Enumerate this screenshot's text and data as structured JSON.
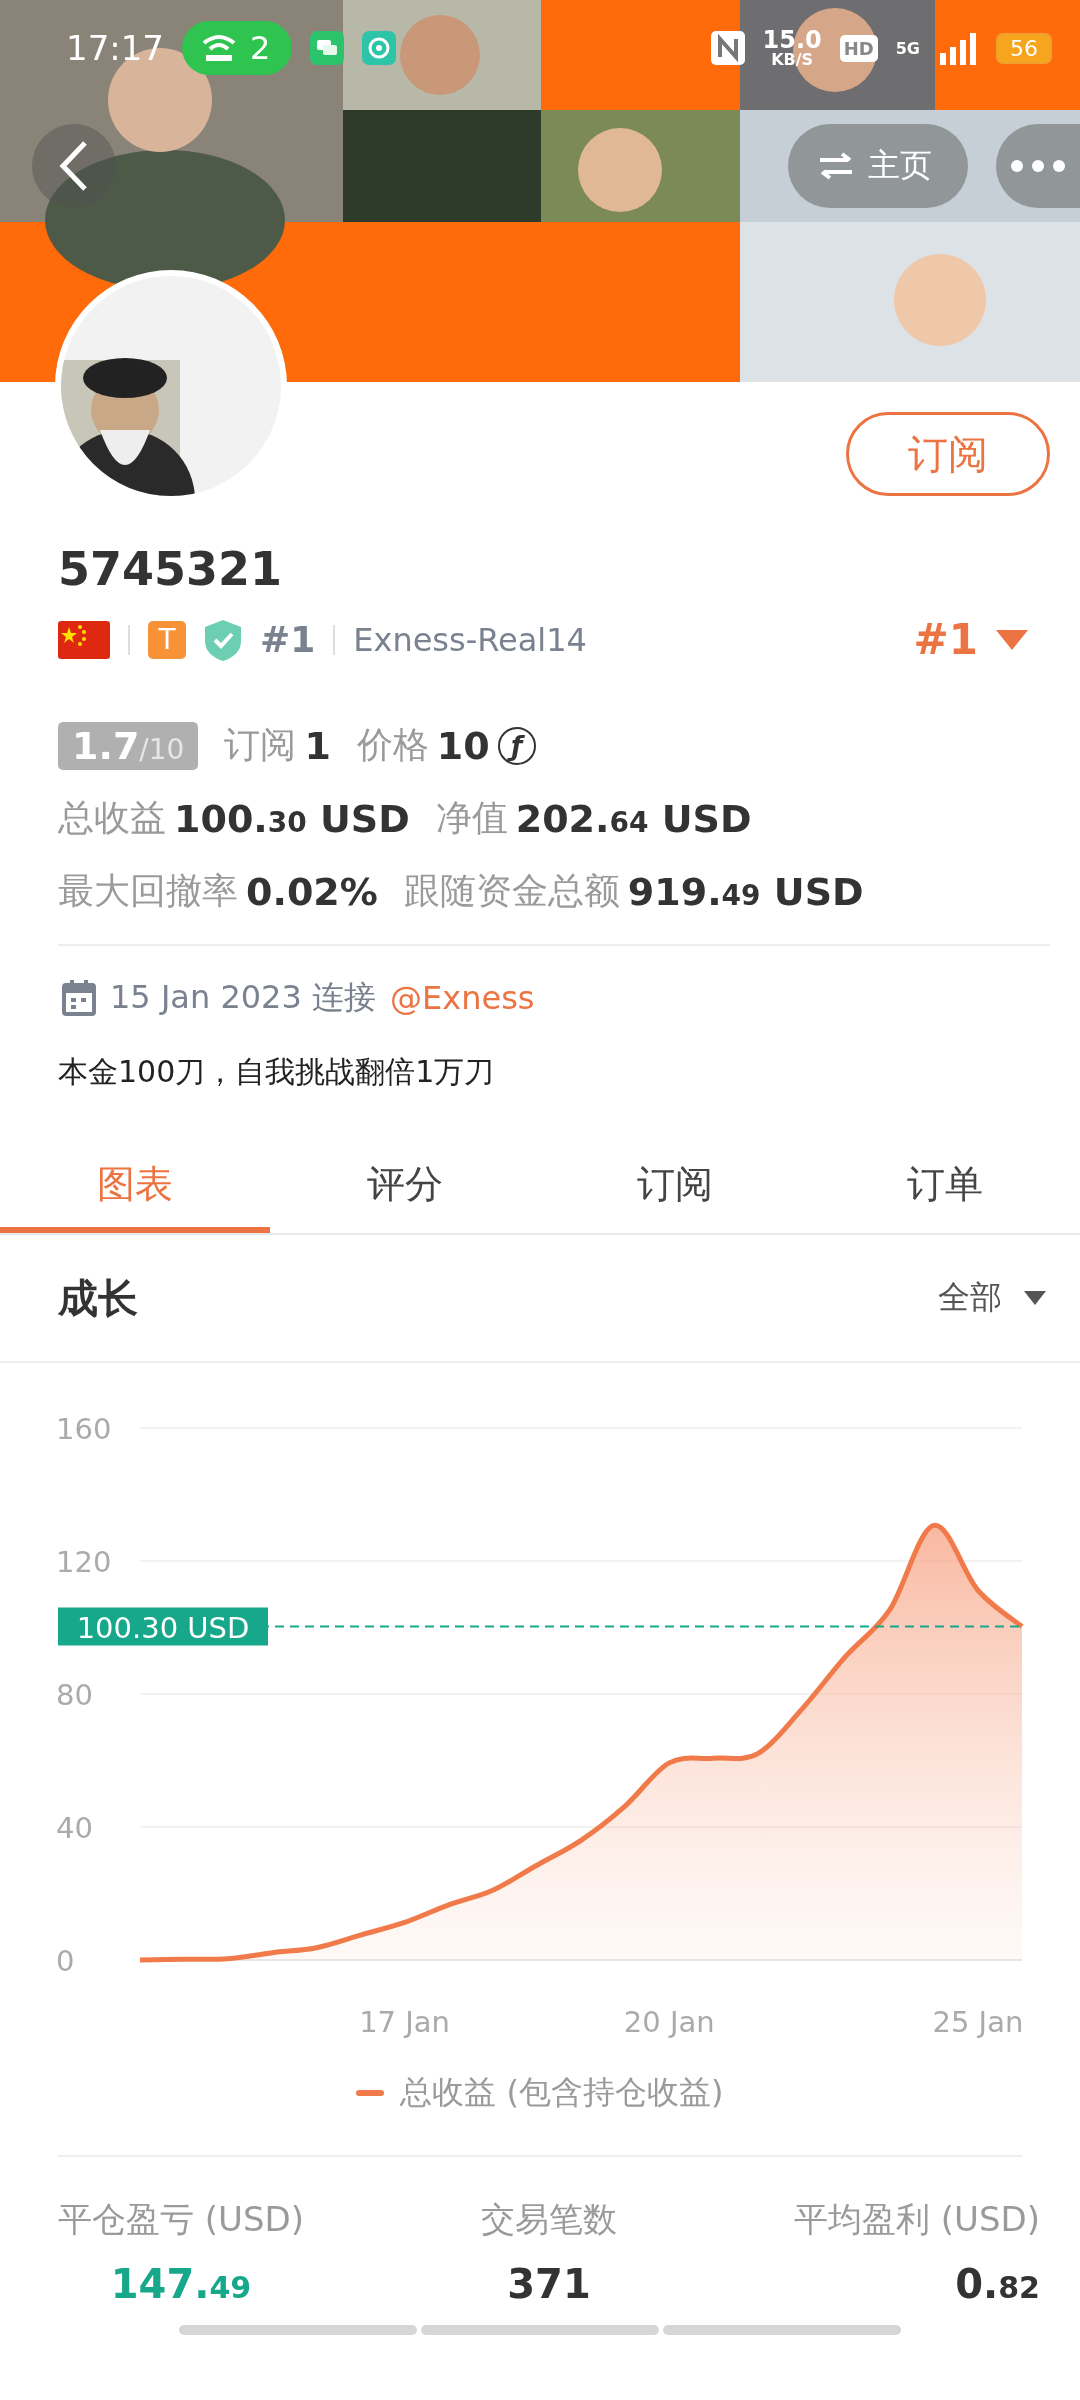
{
  "status_bar": {
    "time": "17:17",
    "hotspot_count": "2",
    "net_speed": "15.0",
    "net_speed_unit": "KB/S",
    "hd": "HD",
    "network": "5G",
    "battery": "56"
  },
  "header": {
    "home_button": "主页"
  },
  "profile": {
    "subscribe_button": "订阅",
    "name": "5745321",
    "tier": "T",
    "rank": "#1",
    "server": "Exness-Real14",
    "rank_selector": "#1"
  },
  "score": {
    "value": "1.7",
    "max": "/10"
  },
  "stat_rows": [
    [
      {
        "label": "订阅",
        "value": "1"
      },
      {
        "label": "价格",
        "value": "10",
        "currency_symbol": "ƒ"
      }
    ],
    [
      {
        "label": "总收益",
        "value": "100.30 USD",
        "small_cents": true
      },
      {
        "label": "净值",
        "value": "202.64 USD",
        "small_cents": true
      }
    ],
    [
      {
        "label": "最大回撤率",
        "value": "0.02%",
        "small_cents": false
      },
      {
        "label": "跟随资金总额",
        "value": "919.49 USD",
        "small_cents": true
      }
    ]
  ],
  "connected": {
    "date": "15 Jan 2023 连接",
    "broker": "@Exness"
  },
  "bio": "本金100刀，自我挑战翻倍1万刀",
  "tabs": [
    {
      "label": "图表",
      "selected": true
    },
    {
      "label": "评分",
      "selected": false
    },
    {
      "label": "订阅",
      "selected": false
    },
    {
      "label": "订单",
      "selected": false
    }
  ],
  "chart_panel": {
    "title": "成长",
    "filter": "全部",
    "chart_data": {
      "type": "area",
      "grid": true,
      "ylim": [
        0,
        160
      ],
      "yticks": [
        0,
        40,
        80,
        120,
        160
      ],
      "categories": [
        null,
        null,
        null,
        null,
        null,
        null,
        "17 Jan",
        null,
        null,
        null,
        null,
        null,
        "20 Jan",
        null,
        null,
        null,
        null,
        null,
        null,
        "25 Jan",
        null
      ],
      "series": [
        {
          "name": "总收益 (包含持仓收益)",
          "color": "#f07a4a",
          "values": [
            0,
            0.2,
            0.4,
            2.2,
            3.7,
            7.5,
            11.3,
            16.6,
            21,
            28.5,
            36,
            46.3,
            59.3,
            60.7,
            62,
            75.3,
            91.3,
            105.3,
            130.7,
            111.2,
            100.3
          ]
        }
      ],
      "ref_lines": [
        {
          "axis": "y",
          "value": 100.3,
          "label": "100.30 USD"
        }
      ]
    }
  },
  "summary": [
    {
      "label": "平仓盈亏 (USD)",
      "value": "147.49",
      "small_cents": true,
      "kind": "profit"
    },
    {
      "label": "交易笔数",
      "value": "371",
      "kind": "plain"
    },
    {
      "label": "平均盈利 (USD)",
      "value": "0.82",
      "small_cents": true,
      "kind": "plain"
    }
  ]
}
